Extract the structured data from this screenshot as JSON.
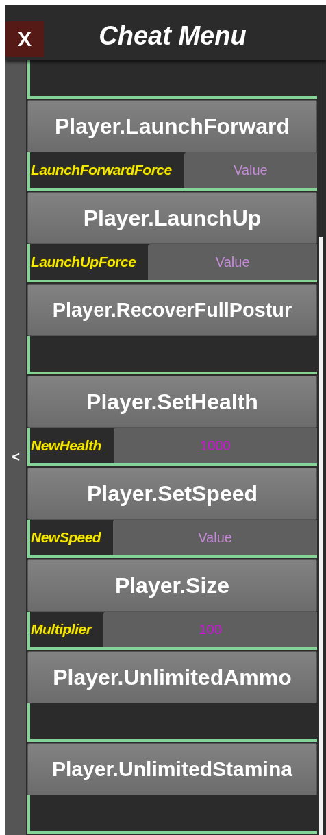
{
  "window": {
    "title": "Cheat Menu",
    "close_label": "X"
  },
  "sidebar": {
    "toggle_label": "<"
  },
  "commands": [
    {
      "label": "Player.LaunchForward",
      "params": [
        {
          "label": "LaunchForwardForce",
          "placeholder": "Value"
        }
      ]
    },
    {
      "label": "Player.LaunchUp",
      "params": [
        {
          "label": "LaunchUpForce",
          "placeholder": "Value"
        }
      ]
    },
    {
      "label": "Player.RecoverFullPostur"
    },
    {
      "label": "Player.SetHealth",
      "params": [
        {
          "label": "NewHealth",
          "value": "1000"
        }
      ]
    },
    {
      "label": "Player.SetSpeed",
      "params": [
        {
          "label": "NewSpeed",
          "placeholder": "Value"
        }
      ]
    },
    {
      "label": "Player.Size",
      "params": [
        {
          "label": "Multiplier",
          "value": "100"
        }
      ]
    },
    {
      "label": "Player.UnlimitedAmmo"
    },
    {
      "label": "Player.UnlimitedStamina"
    }
  ]
}
